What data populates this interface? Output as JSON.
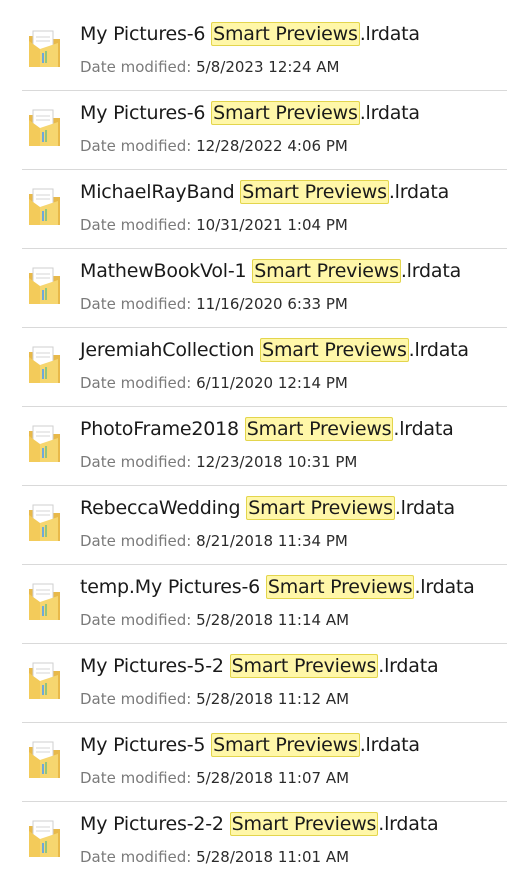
{
  "meta_label": "Date modified:",
  "highlight": "Smart Previews",
  "items": [
    {
      "pre": "My Pictures-6 ",
      "post": ".lrdata",
      "date": "5/8/2023 12:24 AM"
    },
    {
      "pre": "My Pictures-6 ",
      "post": ".lrdata",
      "date": "12/28/2022 4:06 PM"
    },
    {
      "pre": "MichaelRayBand ",
      "post": ".lrdata",
      "date": "10/31/2021 1:04 PM"
    },
    {
      "pre": "MathewBookVol-1 ",
      "post": ".lrdata",
      "date": "11/16/2020 6:33 PM"
    },
    {
      "pre": "JeremiahCollection ",
      "post": ".lrdata",
      "date": "6/11/2020 12:14 PM"
    },
    {
      "pre": "PhotoFrame2018 ",
      "post": ".lrdata",
      "date": "12/23/2018 10:31 PM"
    },
    {
      "pre": "RebeccaWedding ",
      "post": ".lrdata",
      "date": "8/21/2018 11:34 PM"
    },
    {
      "pre": "temp.My Pictures-6 ",
      "post": ".lrdata",
      "date": "5/28/2018 11:14 AM"
    },
    {
      "pre": "My Pictures-5-2 ",
      "post": ".lrdata",
      "date": "5/28/2018 11:12 AM"
    },
    {
      "pre": "My Pictures-5 ",
      "post": ".lrdata",
      "date": "5/28/2018 11:07 AM"
    },
    {
      "pre": "My Pictures-2-2 ",
      "post": ".lrdata",
      "date": "5/28/2018 11:01 AM"
    }
  ]
}
